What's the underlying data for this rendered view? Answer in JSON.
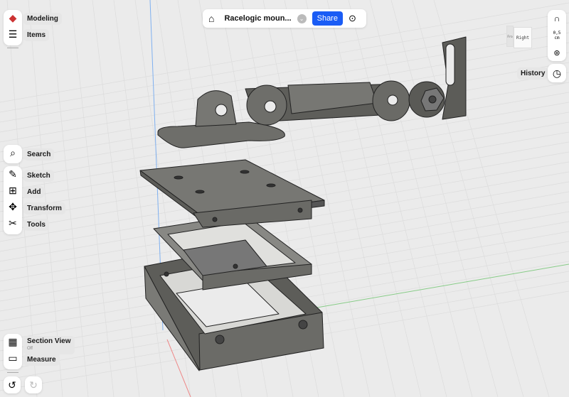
{
  "topbar": {
    "title": "Racelogic moun...",
    "share": "Share"
  },
  "left_top": [
    {
      "label": "Modeling",
      "icon": "modeling-cube-icon"
    },
    {
      "label": "Items",
      "icon": "layers-icon"
    }
  ],
  "left_mid": [
    {
      "label": "Search",
      "icon": "search-icon"
    },
    {
      "label": "Sketch",
      "icon": "sketch-icon"
    },
    {
      "label": "Add",
      "icon": "add-icon"
    },
    {
      "label": "Transform",
      "icon": "transform-icon"
    },
    {
      "label": "Tools",
      "icon": "tools-icon"
    }
  ],
  "left_bottom": {
    "section_view": "Section View",
    "section_state": "Off",
    "measure": "Measure"
  },
  "right": {
    "snap": "0,5\ncm",
    "history": "History",
    "view_cube_face": "Right",
    "view_cube_side": "Fro"
  },
  "colors": {
    "accent": "#1a5cf5",
    "model": "#6f6f6c",
    "background": "#ebebeb"
  }
}
